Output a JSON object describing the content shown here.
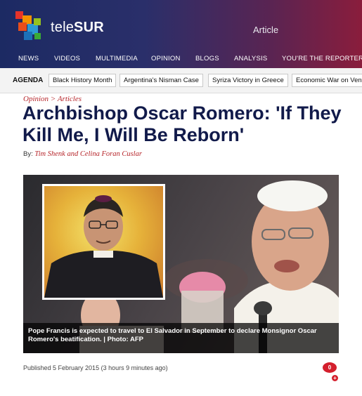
{
  "header": {
    "logo_text_light": "tele",
    "logo_text_bold": "SUR",
    "section_label": "Article"
  },
  "nav": {
    "items": [
      "NEWS",
      "VIDEOS",
      "MULTIMEDIA",
      "OPINION",
      "BLOGS",
      "ANALYSIS",
      "YOU'RE THE REPORTER"
    ]
  },
  "agenda": {
    "label": "AGENDA",
    "items": [
      "Black History Month",
      "Argentina's Nisman Case",
      "Syriza Victory in Greece",
      "Economic War on Ven"
    ]
  },
  "article": {
    "breadcrumb": {
      "section": "Opinion",
      "separator": ">",
      "subsection": "Articles"
    },
    "title": "Archbishop Oscar Romero: 'If They Kill Me, I Will Be Reborn'",
    "byline_prefix": "By:",
    "authors": "Tim Shenk and Celina Foran Cuslar",
    "image_caption": "Pope Francis is expected to travel to El Salvador in September to declare Monsignor Oscar Romero's beatification. | Photo: AFP",
    "published": "Published 5 February 2015 (3 hours 9 minutes ago)",
    "comment_count": "0",
    "comment_plus": "+"
  },
  "colors": {
    "header_start": "#1c2a63",
    "header_end": "#8a1d3c",
    "accent_red": "#b6252a",
    "title_navy": "#111a4a"
  }
}
